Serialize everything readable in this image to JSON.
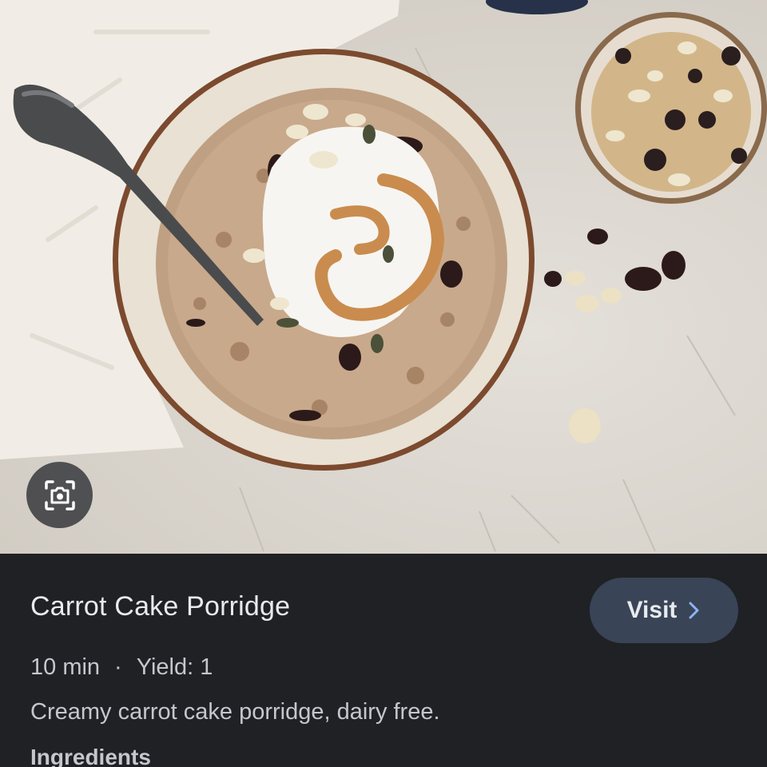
{
  "image": {
    "description_icon": "recipe-photo",
    "lens_button_icon": "image-search-icon"
  },
  "result": {
    "title": "Carrot Cake Porridge",
    "visit_label": "Visit",
    "visit_icon": "chevron-right-icon",
    "time": "10 min",
    "separator": "·",
    "yield": "Yield: 1",
    "description": "Creamy carrot cake porridge, dairy free.",
    "section_heading": "Ingredients"
  },
  "colors": {
    "panel_bg": "#1f2125",
    "button_bg": "#394457",
    "chevron": "#8ab4f8",
    "text_primary": "#e8eaed",
    "text_secondary": "#c4c7cc"
  }
}
